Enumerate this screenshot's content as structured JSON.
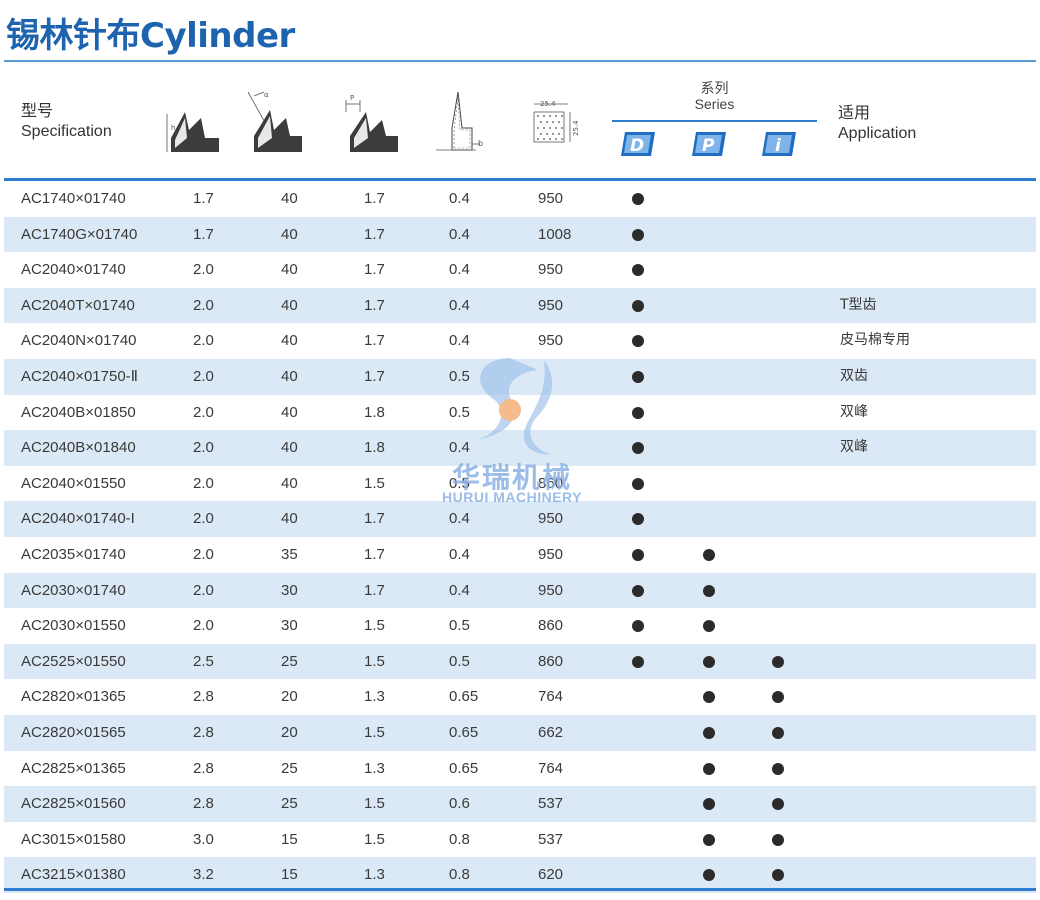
{
  "title": "锡林针布Cylinder",
  "header": {
    "spec_cn": "型号",
    "spec_en": "Specification",
    "series_cn": "系列",
    "series_en": "Series",
    "app_cn": "适用",
    "app_en": "Application",
    "dim_w": "25.4",
    "dim_h": "25.4",
    "dim_p": "P",
    "dim_b": "b",
    "dim_h2": "h",
    "dim_a": "α",
    "series_badges": [
      "D",
      "P",
      "i"
    ]
  },
  "watermark": {
    "cn": "华瑞机械",
    "en": "HURUI MACHINERY"
  },
  "rows": [
    {
      "spec": "AC1740×01740",
      "h": "1.7",
      "angle": "40",
      "p": "1.7",
      "b": "0.4",
      "density": "950",
      "d": true,
      "pp": false,
      "i": false,
      "app": ""
    },
    {
      "spec": "AC1740G×01740",
      "h": "1.7",
      "angle": "40",
      "p": "1.7",
      "b": "0.4",
      "density": "1008",
      "d": true,
      "pp": false,
      "i": false,
      "app": ""
    },
    {
      "spec": "AC2040×01740",
      "h": "2.0",
      "angle": "40",
      "p": "1.7",
      "b": "0.4",
      "density": "950",
      "d": true,
      "pp": false,
      "i": false,
      "app": ""
    },
    {
      "spec": "AC2040T×01740",
      "h": "2.0",
      "angle": "40",
      "p": "1.7",
      "b": "0.4",
      "density": "950",
      "d": true,
      "pp": false,
      "i": false,
      "app": "T型齿"
    },
    {
      "spec": "AC2040N×01740",
      "h": "2.0",
      "angle": "40",
      "p": "1.7",
      "b": "0.4",
      "density": "950",
      "d": true,
      "pp": false,
      "i": false,
      "app": "皮马棉专用"
    },
    {
      "spec": "AC2040×01750-Ⅱ",
      "h": "2.0",
      "angle": "40",
      "p": "1.7",
      "b": "0.5",
      "density": "",
      "d": true,
      "pp": false,
      "i": false,
      "app": "双齿"
    },
    {
      "spec": "AC2040B×01850",
      "h": "2.0",
      "angle": "40",
      "p": "1.8",
      "b": "0.5",
      "density": "",
      "d": true,
      "pp": false,
      "i": false,
      "app": "双峰"
    },
    {
      "spec": "AC2040B×01840",
      "h": "2.0",
      "angle": "40",
      "p": "1.8",
      "b": "0.4",
      "density": "",
      "d": true,
      "pp": false,
      "i": false,
      "app": "双峰"
    },
    {
      "spec": "AC2040×01550",
      "h": "2.0",
      "angle": "40",
      "p": "1.5",
      "b": "0.5",
      "density": "860",
      "d": true,
      "pp": false,
      "i": false,
      "app": ""
    },
    {
      "spec": "AC2040×01740-I",
      "h": "2.0",
      "angle": "40",
      "p": "1.7",
      "b": "0.4",
      "density": "950",
      "d": true,
      "pp": false,
      "i": false,
      "app": ""
    },
    {
      "spec": "AC2035×01740",
      "h": "2.0",
      "angle": "35",
      "p": "1.7",
      "b": "0.4",
      "density": "950",
      "d": true,
      "pp": true,
      "i": false,
      "app": ""
    },
    {
      "spec": "AC2030×01740",
      "h": "2.0",
      "angle": "30",
      "p": "1.7",
      "b": "0.4",
      "density": "950",
      "d": true,
      "pp": true,
      "i": false,
      "app": ""
    },
    {
      "spec": "AC2030×01550",
      "h": "2.0",
      "angle": "30",
      "p": "1.5",
      "b": "0.5",
      "density": "860",
      "d": true,
      "pp": true,
      "i": false,
      "app": ""
    },
    {
      "spec": "AC2525×01550",
      "h": "2.5",
      "angle": "25",
      "p": "1.5",
      "b": "0.5",
      "density": "860",
      "d": true,
      "pp": true,
      "i": true,
      "app": ""
    },
    {
      "spec": "AC2820×01365",
      "h": "2.8",
      "angle": "20",
      "p": "1.3",
      "b": "0.65",
      "density": "764",
      "d": false,
      "pp": true,
      "i": true,
      "app": ""
    },
    {
      "spec": "AC2820×01565",
      "h": "2.8",
      "angle": "20",
      "p": "1.5",
      "b": "0.65",
      "density": "662",
      "d": false,
      "pp": true,
      "i": true,
      "app": ""
    },
    {
      "spec": "AC2825×01365",
      "h": "2.8",
      "angle": "25",
      "p": "1.3",
      "b": "0.65",
      "density": "764",
      "d": false,
      "pp": true,
      "i": true,
      "app": ""
    },
    {
      "spec": "AC2825×01560",
      "h": "2.8",
      "angle": "25",
      "p": "1.5",
      "b": "0.6",
      "density": "537",
      "d": false,
      "pp": true,
      "i": true,
      "app": ""
    },
    {
      "spec": "AC3015×01580",
      "h": "3.0",
      "angle": "15",
      "p": "1.5",
      "b": "0.8",
      "density": "537",
      "d": false,
      "pp": true,
      "i": true,
      "app": ""
    },
    {
      "spec": "AC3215×01380",
      "h": "3.2",
      "angle": "15",
      "p": "1.3",
      "b": "0.8",
      "density": "620",
      "d": false,
      "pp": true,
      "i": true,
      "app": ""
    }
  ]
}
